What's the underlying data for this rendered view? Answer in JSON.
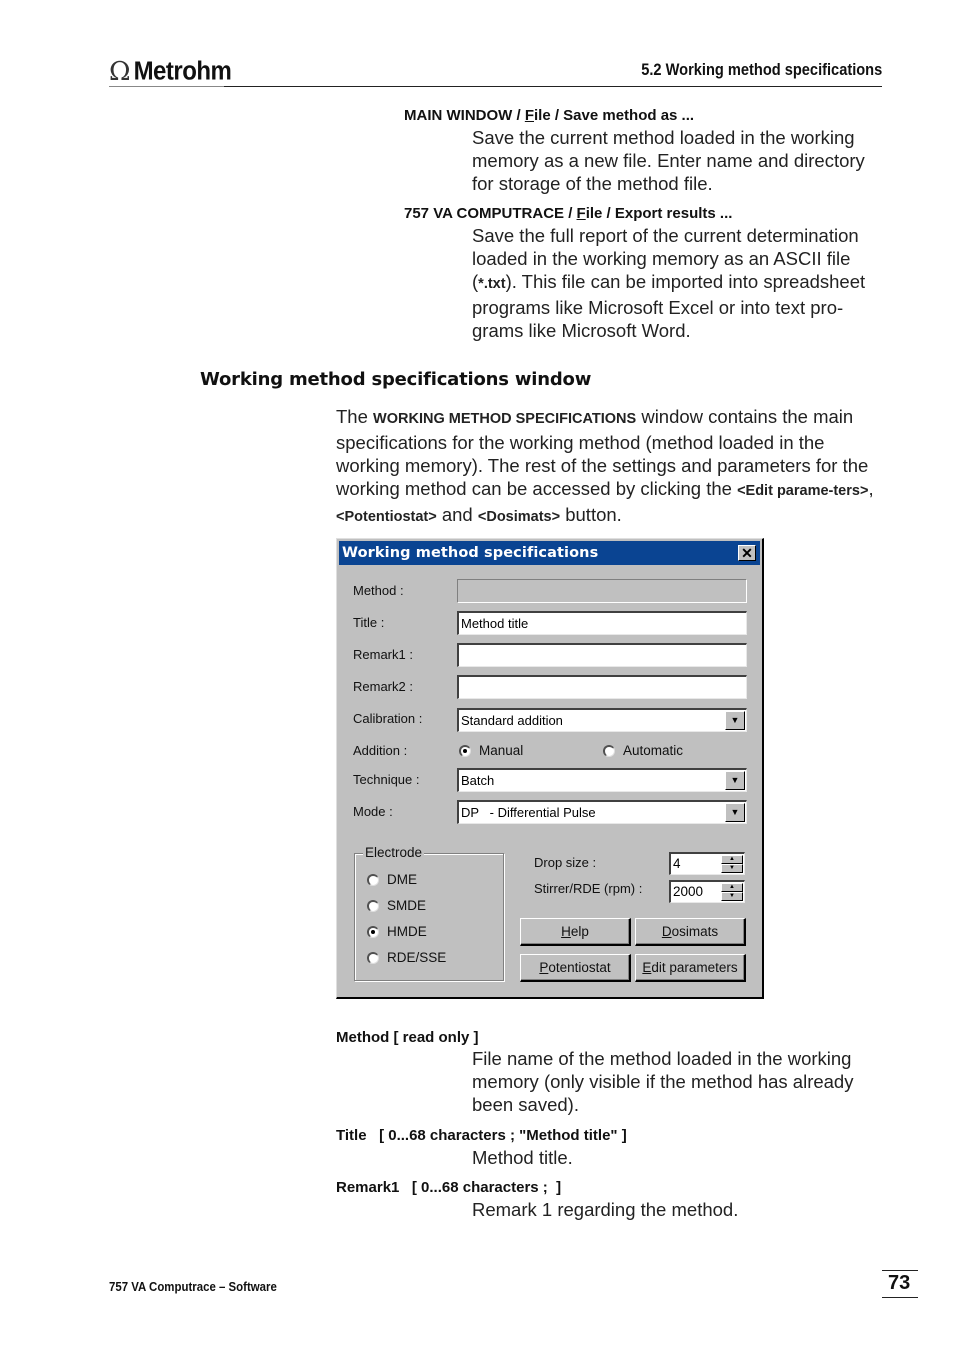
{
  "header": {
    "logo_symbol": "Ω",
    "logo_text": "Metrohm",
    "section": "5.2  Working method specifications"
  },
  "menu_entries": [
    {
      "path_prefix": "MAIN WINDOW / ",
      "path_underlined_letter": "F",
      "path_rest": "ile / Save method as ...",
      "description": "Save the current method loaded in the working memory as a new file. Enter name and directory for storage of the method file."
    },
    {
      "path_prefix": "757 VA COMPUTRACE / ",
      "path_underlined_letter": "F",
      "path_rest": "ile / Export results ...",
      "description_before": "Save the full report of the current determination loaded in the working memory as an ASCII file (",
      "description_bold": "*.txt",
      "description_after": "). This file can be imported into spreadsheet programs like Microsoft Excel or into text pro-grams like Microsoft Word."
    }
  ],
  "section_heading": "Working method specifications window",
  "intro": {
    "t1": "The ",
    "b1": "WORKING METHOD SPECIFICATIONS",
    "t2": " window contains the main specifications for the working method (method loaded in the working memory). The rest of the settings and parameters for the working method can be accessed by clicking the ",
    "b2": "<Edit parame-ters>",
    "t3": ", ",
    "b3": "<Potentiostat>",
    "t4": " and ",
    "b4": "<Dosimats>",
    "t5": " button."
  },
  "dialog": {
    "title": "Working method specifications",
    "close_label": "✕",
    "method_label": "Method :",
    "method_value": "",
    "title_label": "Title :",
    "title_value": "Method title",
    "remark1_label": "Remark1 :",
    "remark1_value": "",
    "remark2_label": "Remark2 :",
    "remark2_value": "",
    "calibration_label": "Calibration :",
    "calibration_value": "Standard addition",
    "addition_label": "Addition :",
    "addition_options": [
      {
        "label": "Manual",
        "selected": true
      },
      {
        "label": "Automatic",
        "selected": false
      }
    ],
    "technique_label": "Technique :",
    "technique_value": "Batch",
    "mode_label": "Mode :",
    "mode_value": "DP   - Differential Pulse",
    "electrode_group": "Electrode",
    "electrode_options": [
      {
        "label": "DME",
        "selected": false
      },
      {
        "label": "SMDE",
        "selected": false
      },
      {
        "label": "HMDE",
        "selected": true
      },
      {
        "label": "RDE/SSE",
        "selected": false
      }
    ],
    "drop_size_label": "Drop size :",
    "drop_size_value": "4",
    "stirrer_label": "Stirrer/RDE (rpm) :",
    "stirrer_value": "2000",
    "buttons": {
      "help": {
        "u": "H",
        "rest": "elp"
      },
      "dosimats": {
        "u": "D",
        "rest": "osimats"
      },
      "potentiostat": {
        "u": "P",
        "rest": "otentiostat"
      },
      "edit": {
        "u": "E",
        "rest": "dit parameters"
      }
    }
  },
  "params": [
    {
      "name": "Method   [ read only ]",
      "description": "File name of the method loaded in the working memory (only visible if the method has already been saved)."
    },
    {
      "name": "Title   [ 0...68 characters ; \"Method title\" ]",
      "description": "Method title."
    },
    {
      "name": "Remark1   [ 0...68 characters ;  ]",
      "description": "Remark 1 regarding the method."
    }
  ],
  "footer": {
    "product": "757 VA Computrace – Software",
    "page_number": "73"
  }
}
